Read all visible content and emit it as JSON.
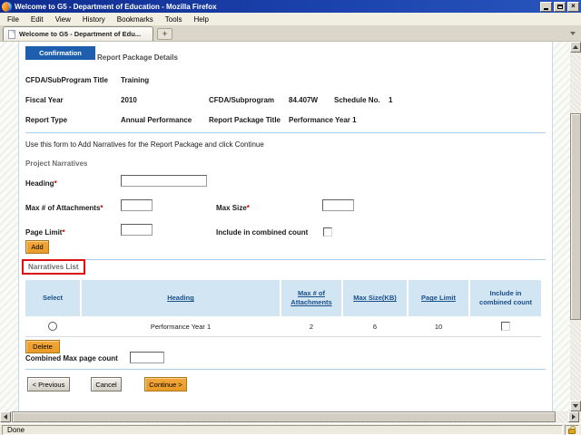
{
  "window": {
    "title": "Welcome to G5 - Department of Education - Mozilla Firefox",
    "menu": [
      "File",
      "Edit",
      "View",
      "History",
      "Bookmarks",
      "Tools",
      "Help"
    ],
    "tab_title": "Welcome to G5 - Department of Edu...",
    "new_tab_glyph": "+",
    "status_text": "Done"
  },
  "page": {
    "confirmation_label": "Confirmation",
    "title": "Report Package Details",
    "details": {
      "cfda_subprogram_title_label": "CFDA/SubProgram Title",
      "cfda_subprogram_title_value": "Training",
      "fiscal_year_label": "Fiscal Year",
      "fiscal_year_value": "2010",
      "cfda_subprogram_label": "CFDA/Subprogram",
      "cfda_subprogram_value": "84.407W",
      "schedule_no_label": "Schedule No.",
      "schedule_no_value": "1",
      "report_type_label": "Report Type",
      "report_type_value": "Annual Performance",
      "report_package_title_label": "Report Package Title",
      "report_package_title_value": "Performance Year 1"
    },
    "instructions": "Use this form to Add Narratives for the Report Package and click Continue",
    "form": {
      "section_title": "Project Narratives",
      "heading_label": "Heading",
      "heading_value": "",
      "max_attachments_label": "Max # of Attachments",
      "max_attachments_value": "",
      "max_size_label": "Max Size",
      "max_size_value": "",
      "page_limit_label": "Page Limit",
      "page_limit_value": "",
      "include_label": "Include in combined count",
      "include_checked": false,
      "required_marker": "*",
      "add_button": "Add"
    },
    "narratives_list": {
      "section_title": "Narratives List",
      "columns": [
        "Select",
        "Heading",
        "Max # of Attachments",
        "Max Size(KB)",
        "Page Limit",
        "Include in combined count"
      ],
      "rows": [
        {
          "heading": "Performance Year 1",
          "max_attachments": "2",
          "max_size": "6",
          "page_limit": "10",
          "include_checked": false,
          "selected": false
        }
      ],
      "delete_button": "Delete",
      "combined_max_label": "Combined Max page count",
      "combined_max_value": ""
    },
    "buttons": {
      "previous": "< Previous",
      "cancel": "Cancel",
      "continue": "Continue >"
    }
  },
  "colors": {
    "titlebar_blue": "#16379e",
    "confirmation_blue": "#1d5fae",
    "table_header_bg": "#d2e5f2",
    "table_header_text": "#1a4f8a",
    "divider_blue": "#a9cdea",
    "button_orange": "#f3a73a",
    "annotation_red": "#dd1111",
    "lock_gold": "#e0a71f"
  }
}
